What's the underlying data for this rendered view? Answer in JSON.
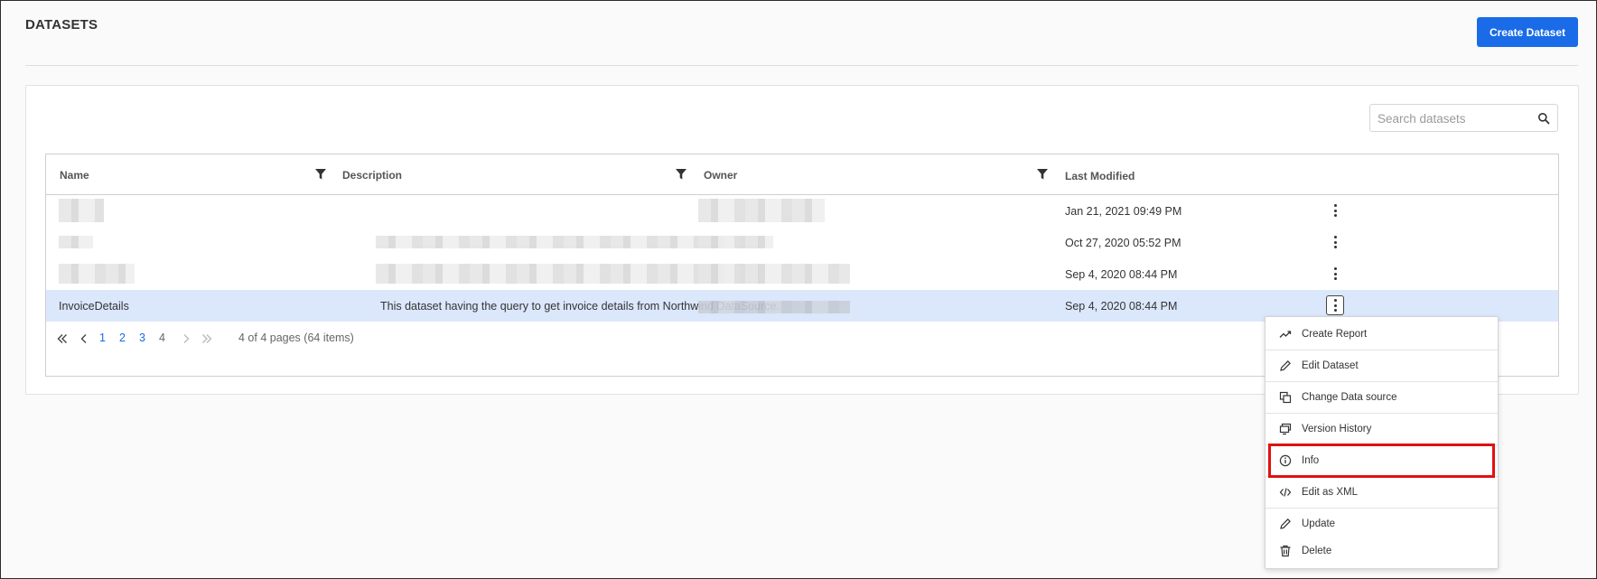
{
  "page": {
    "title": "DATASETS",
    "create_button": "Create Dataset"
  },
  "search": {
    "placeholder": "Search datasets",
    "value": ""
  },
  "table": {
    "columns": [
      {
        "label": "Name",
        "filterable": true
      },
      {
        "label": "Description",
        "filterable": true
      },
      {
        "label": "Owner",
        "filterable": true
      },
      {
        "label": "Last Modified",
        "filterable": false
      }
    ],
    "rows": [
      {
        "name": "",
        "description": "",
        "owner": "",
        "last_modified": "Jan 21, 2021 09:49 PM",
        "selected": false
      },
      {
        "name": "",
        "description": "",
        "owner": "",
        "last_modified": "Oct 27, 2020 05:52 PM",
        "selected": false
      },
      {
        "name": "",
        "description": "",
        "owner": "",
        "last_modified": "Sep 4, 2020 08:44 PM",
        "selected": false
      },
      {
        "name": "InvoiceDetails",
        "description": "This dataset having the query to get invoice details from Northwind DataSource.",
        "owner": "",
        "last_modified": "Sep 4, 2020 08:44 PM",
        "selected": true
      }
    ]
  },
  "pager": {
    "pages": [
      "1",
      "2",
      "3",
      "4"
    ],
    "current_page": "4",
    "info": "4 of 4 pages (64 items)"
  },
  "context_menu": {
    "items": [
      {
        "label": "Create Report",
        "icon": "trend-icon"
      },
      {
        "label": "Edit Dataset",
        "icon": "pencil-icon"
      },
      {
        "label": "Change Data source",
        "icon": "copy-icon"
      },
      {
        "label": "Version History",
        "icon": "history-icon"
      },
      {
        "label": "Info",
        "icon": "info-icon",
        "highlighted": true
      },
      {
        "label": "Edit as XML",
        "icon": "code-icon"
      },
      {
        "label": "Update",
        "icon": "pencil-icon"
      },
      {
        "label": "Delete",
        "icon": "trash-icon"
      }
    ]
  },
  "colors": {
    "accent": "#1a6be8",
    "selected_row": "#dbe7fb",
    "highlight_border": "#e11111"
  }
}
